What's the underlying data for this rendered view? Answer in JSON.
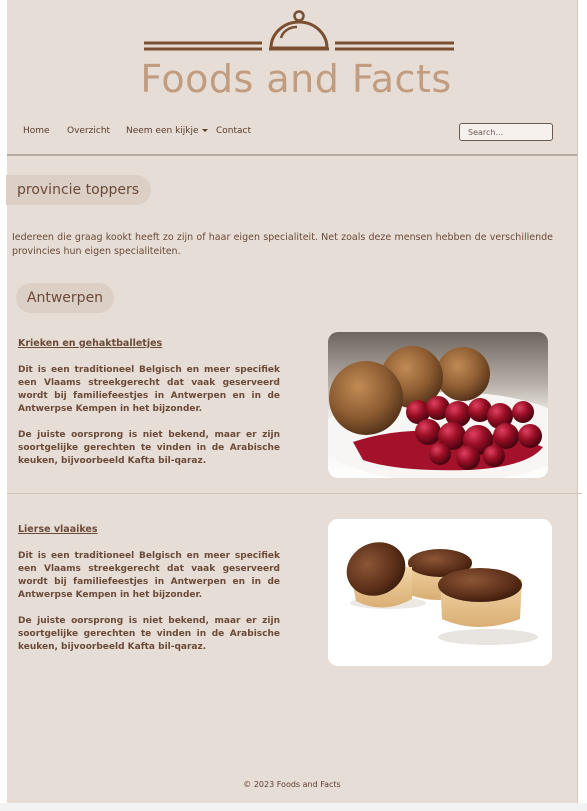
{
  "brand": {
    "name": "Foods and Facts",
    "logo_icon": "cloche-icon",
    "color": "#c29c7e",
    "line_color": "#7a4e30"
  },
  "nav": {
    "items": [
      {
        "label": "Home"
      },
      {
        "label": "Overzicht"
      },
      {
        "label": "Neem een kijkje"
      },
      {
        "label": "Contact"
      }
    ],
    "search_placeholder": "Search..."
  },
  "section": {
    "title": "provincie toppers",
    "intro": "Iedereen die graag kookt heeft zo zijn of haar eigen specialiteit. Net zoals deze mensen hebben de verschillende provincies hun eigen specialiteiten."
  },
  "province": {
    "name": "Antwerpen"
  },
  "dishes": [
    {
      "title": "Krieken en gehaktballetjes",
      "p1": "Dit is een traditioneel Belgisch en meer specifiek een Vlaams streekgerecht dat vaak geserveerd wordt bij familiefeestjes in Antwerpen en in de Antwerpse Kempen in het bijzonder.",
      "p2": "De juiste oorsprong is niet bekend, maar er zijn soortgelijke gerechten te vinden in de Arabische keuken, bijvoorbeeld Kafta bil-qaraz."
    },
    {
      "title": "Lierse vlaaikes",
      "p1": "Dit is een traditioneel Belgisch en meer specifiek een Vlaams streekgerecht dat vaak geserveerd wordt bij familiefeestjes in Antwerpen en in de Antwerpse Kempen in het bijzonder.",
      "p2": "De juiste oorsprong is niet bekend, maar er zijn soortgelijke gerechten te vinden in de Arabische keuken, bijvoorbeeld Kafta bil-qaraz."
    }
  ],
  "footer": {
    "text": "© 2023 Foods and Facts"
  },
  "colors": {
    "background": "#e6ddd6",
    "text": "#6b4a38",
    "pill": "#dccfc6"
  }
}
